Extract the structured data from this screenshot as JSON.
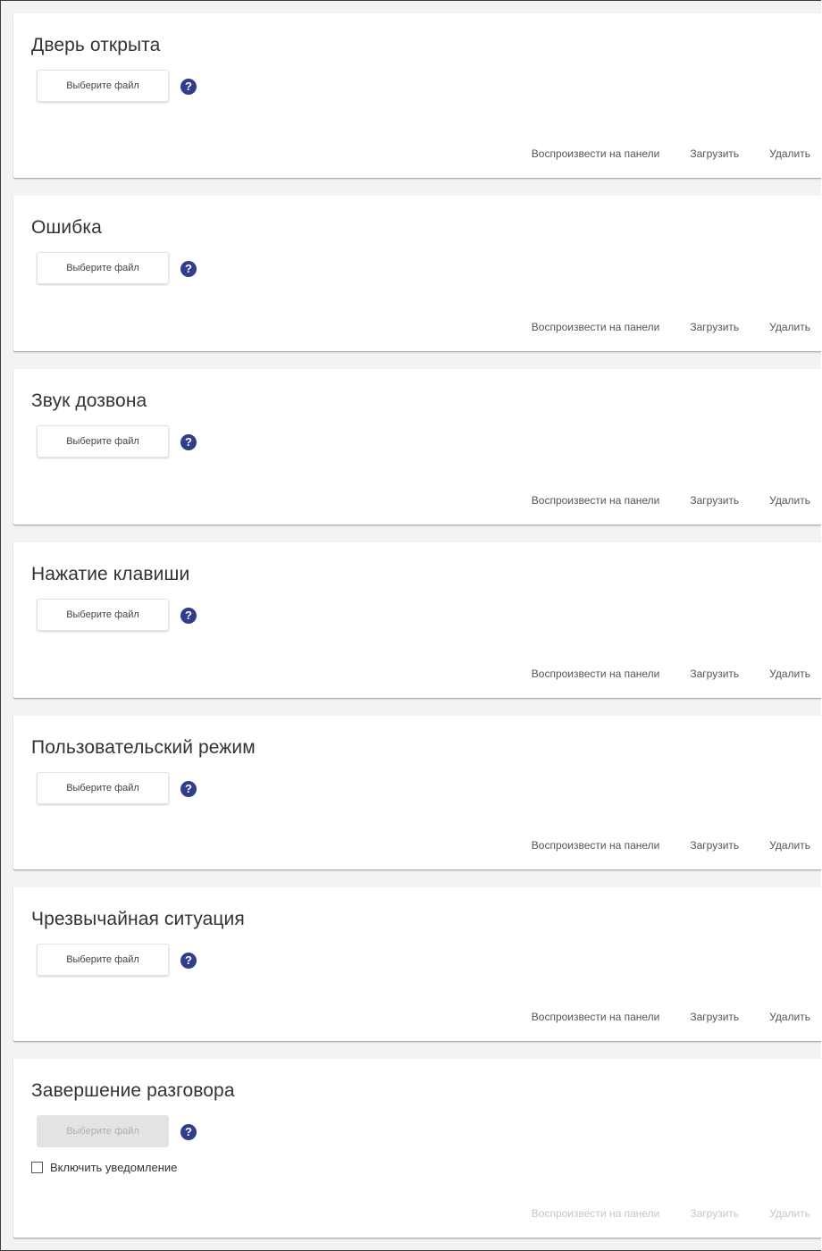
{
  "sections": [
    {
      "title": "Дверь открыта",
      "file_button": "Выберите файл",
      "help_icon": "question-circle-icon",
      "actions": {
        "play": "Воспроизвести на панели",
        "upload": "Загрузить",
        "delete": "Удалить"
      }
    },
    {
      "title": "Ошибка",
      "file_button": "Выберите файл",
      "help_icon": "question-circle-icon",
      "actions": {
        "play": "Воспроизвести на панели",
        "upload": "Загрузить",
        "delete": "Удалить"
      }
    },
    {
      "title": "Звук дозвона",
      "file_button": "Выберите файл",
      "help_icon": "question-circle-icon",
      "actions": {
        "play": "Воспроизвести на панели",
        "upload": "Загрузить",
        "delete": "Удалить"
      }
    },
    {
      "title": "Нажатие клавиши",
      "file_button": "Выберите файл",
      "help_icon": "question-circle-icon",
      "actions": {
        "play": "Воспроизвести на панели",
        "upload": "Загрузить",
        "delete": "Удалить"
      }
    },
    {
      "title": "Пользовательский режим",
      "file_button": "Выберите файл",
      "help_icon": "question-circle-icon",
      "actions": {
        "play": "Воспроизвести на панели",
        "upload": "Загрузить",
        "delete": "Удалить"
      }
    },
    {
      "title": "Чрезвычайная ситуация",
      "file_button": "Выберите файл",
      "help_icon": "question-circle-icon",
      "actions": {
        "play": "Воспроизвести на панели",
        "upload": "Загрузить",
        "delete": "Удалить"
      }
    },
    {
      "title": "Завершение разговора",
      "file_button": "Выберите файл",
      "help_icon": "question-circle-icon",
      "disabled": true,
      "notification_label": "Включить уведомление",
      "notification_checked": false,
      "actions": {
        "play": "Воспроизвести на панели",
        "upload": "Загрузить",
        "delete": "Удалить"
      }
    }
  ],
  "colors": {
    "help_icon": "#2f3d8c",
    "page_background": "#f3f3f3",
    "card_background": "#ffffff",
    "disabled_text": "#c6c6c6"
  }
}
